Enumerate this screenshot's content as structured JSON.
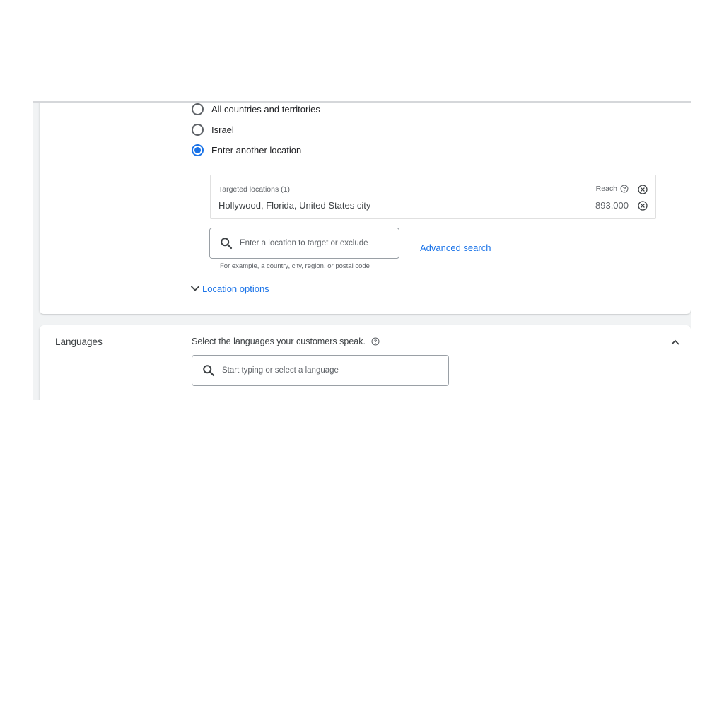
{
  "locations": {
    "radio_options": [
      {
        "label": "All countries and territories",
        "checked": false
      },
      {
        "label": "Israel",
        "checked": false
      },
      {
        "label": "Enter another location",
        "checked": true
      }
    ],
    "targeted": {
      "header": "Targeted locations (1)",
      "reach_label": "Reach",
      "items": [
        {
          "name": "Hollywood, Florida, United States city",
          "reach": "893,000"
        }
      ]
    },
    "search": {
      "placeholder": "Enter a location to target or exclude",
      "helper_text": "For example, a country, city, region, or postal code"
    },
    "advanced_search_label": "Advanced search",
    "location_options_label": "Location options"
  },
  "languages": {
    "title": "Languages",
    "description": "Select the languages your customers speak.",
    "search_placeholder": "Start typing or select a language"
  },
  "colors": {
    "accent": "#1a73e8",
    "text": "#3c4043",
    "muted": "#5f6368"
  }
}
